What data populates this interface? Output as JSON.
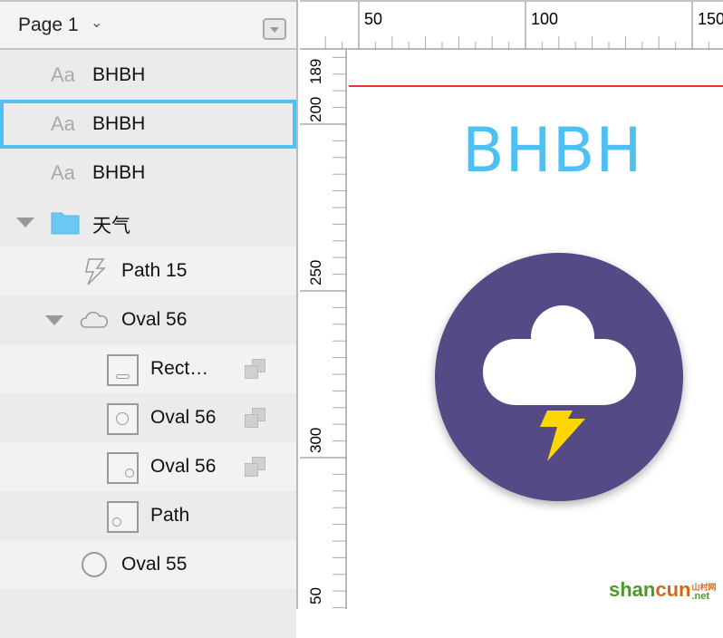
{
  "header": {
    "page_label": "Page 1",
    "chevron": "chevron-down-icon",
    "collapse_icon": "collapse-icon"
  },
  "layers": [
    {
      "label": "BHBH",
      "icon": "Aa"
    },
    {
      "label": "BHBH",
      "icon": "Aa",
      "selected": true
    },
    {
      "label": "BHBH",
      "icon": "Aa"
    },
    {
      "label": "天气",
      "icon": "folder-icon"
    },
    {
      "label": "Path 15",
      "icon": "path-icon"
    },
    {
      "label": "Oval 56",
      "icon": "cloud-icon"
    },
    {
      "label": "Rect…",
      "icon": "rect-icon",
      "mask": true
    },
    {
      "label": "Oval 56",
      "icon": "oval-icon",
      "mask": true
    },
    {
      "label": "Oval 56",
      "icon": "oval-icon",
      "mask": true
    },
    {
      "label": "Path",
      "icon": "oval-icon"
    },
    {
      "label": "Oval 55",
      "icon": "circle-icon"
    }
  ],
  "ruler": {
    "h_labels": [
      "50",
      "100",
      "150"
    ],
    "v_labels": [
      "189",
      "200",
      "250",
      "300",
      "50"
    ]
  },
  "canvas": {
    "text": "BHBH",
    "text_color": "#4fc0f3",
    "circle_color": "#544886",
    "bolt_color": "#ffd600",
    "guide_color": "#ee3333"
  },
  "watermark": {
    "text1": "shan",
    "text2": "cun",
    "text3": "山村网",
    "text4": ".net"
  }
}
